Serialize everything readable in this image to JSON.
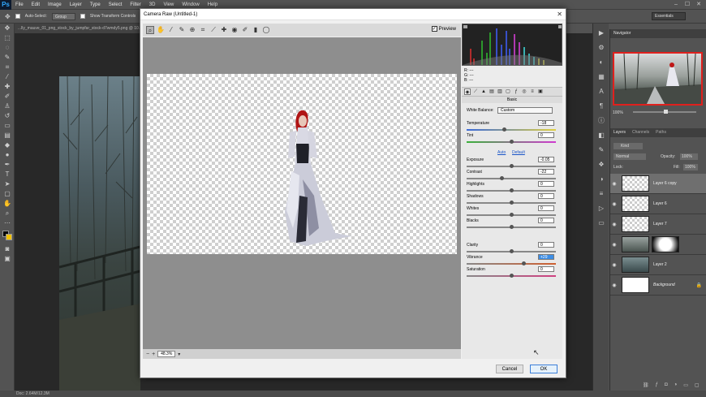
{
  "app": {
    "logo": "Ps"
  },
  "menubar": {
    "items": [
      "File",
      "Edit",
      "Image",
      "Layer",
      "Type",
      "Select",
      "Filter",
      "3D",
      "View",
      "Window",
      "Help"
    ],
    "window_controls": [
      "–",
      "☐",
      "✕"
    ]
  },
  "options": {
    "auto_select": "Auto-Select:",
    "auto_select_target": "Group",
    "transform_controls": "Show Transform Controls",
    "workspace": "Essentials"
  },
  "document": {
    "tab": "...lly_mauve_01_png_stock_by_jumpfar_stock-d7wmdy5.png @ 10...",
    "status": "Doc: 2.64M/12.3M"
  },
  "navigator": {
    "tab": "Navigator",
    "zoom": "100%"
  },
  "layers_panel": {
    "tabs": [
      "Layers",
      "Channels",
      "Paths"
    ],
    "filter": "Kind",
    "blend_mode": "Normal",
    "opacity_label": "Opacity:",
    "opacity": "100%",
    "lock_label": "Lock:",
    "fill_label": "Fill:",
    "fill": "100%",
    "layers": [
      {
        "name": "Layer 6 copy",
        "selected": true
      },
      {
        "name": "Layer 6",
        "selected": false
      },
      {
        "name": "Layer 7",
        "selected": false
      },
      {
        "name": "",
        "selected": false
      },
      {
        "name": "Layer 2",
        "selected": false
      },
      {
        "name": "Background",
        "selected": false
      }
    ]
  },
  "dialog": {
    "title": "Camera Raw (Untitled-1)",
    "preview_label": "Preview",
    "zoom": "48.3%",
    "readout": {
      "r": "R: ---",
      "g": "G: ---",
      "b": "B: ---"
    },
    "panel_name": "Basic",
    "white_balance_label": "White Balance:",
    "white_balance": "Custom",
    "auto_link": "Auto",
    "default_link": "Default",
    "sliders": [
      {
        "label": "Temperature",
        "value": "-18",
        "pos": 0.42
      },
      {
        "label": "Tint",
        "value": "0",
        "pos": 0.5
      },
      {
        "label": "Exposure",
        "value": "-0.05",
        "pos": 0.5
      },
      {
        "label": "Contrast",
        "value": "-22",
        "pos": 0.39
      },
      {
        "label": "Highlights",
        "value": "0",
        "pos": 0.5
      },
      {
        "label": "Shadows",
        "value": "0",
        "pos": 0.5
      },
      {
        "label": "Whites",
        "value": "0",
        "pos": 0.5
      },
      {
        "label": "Blacks",
        "value": "0",
        "pos": 0.5
      },
      {
        "label": "Clarity",
        "value": "0",
        "pos": 0.5
      },
      {
        "label": "Vibrance",
        "value": "+29",
        "pos": 0.65
      },
      {
        "label": "Saturation",
        "value": "0",
        "pos": 0.5
      }
    ],
    "cancel": "Cancel",
    "ok": "OK"
  }
}
